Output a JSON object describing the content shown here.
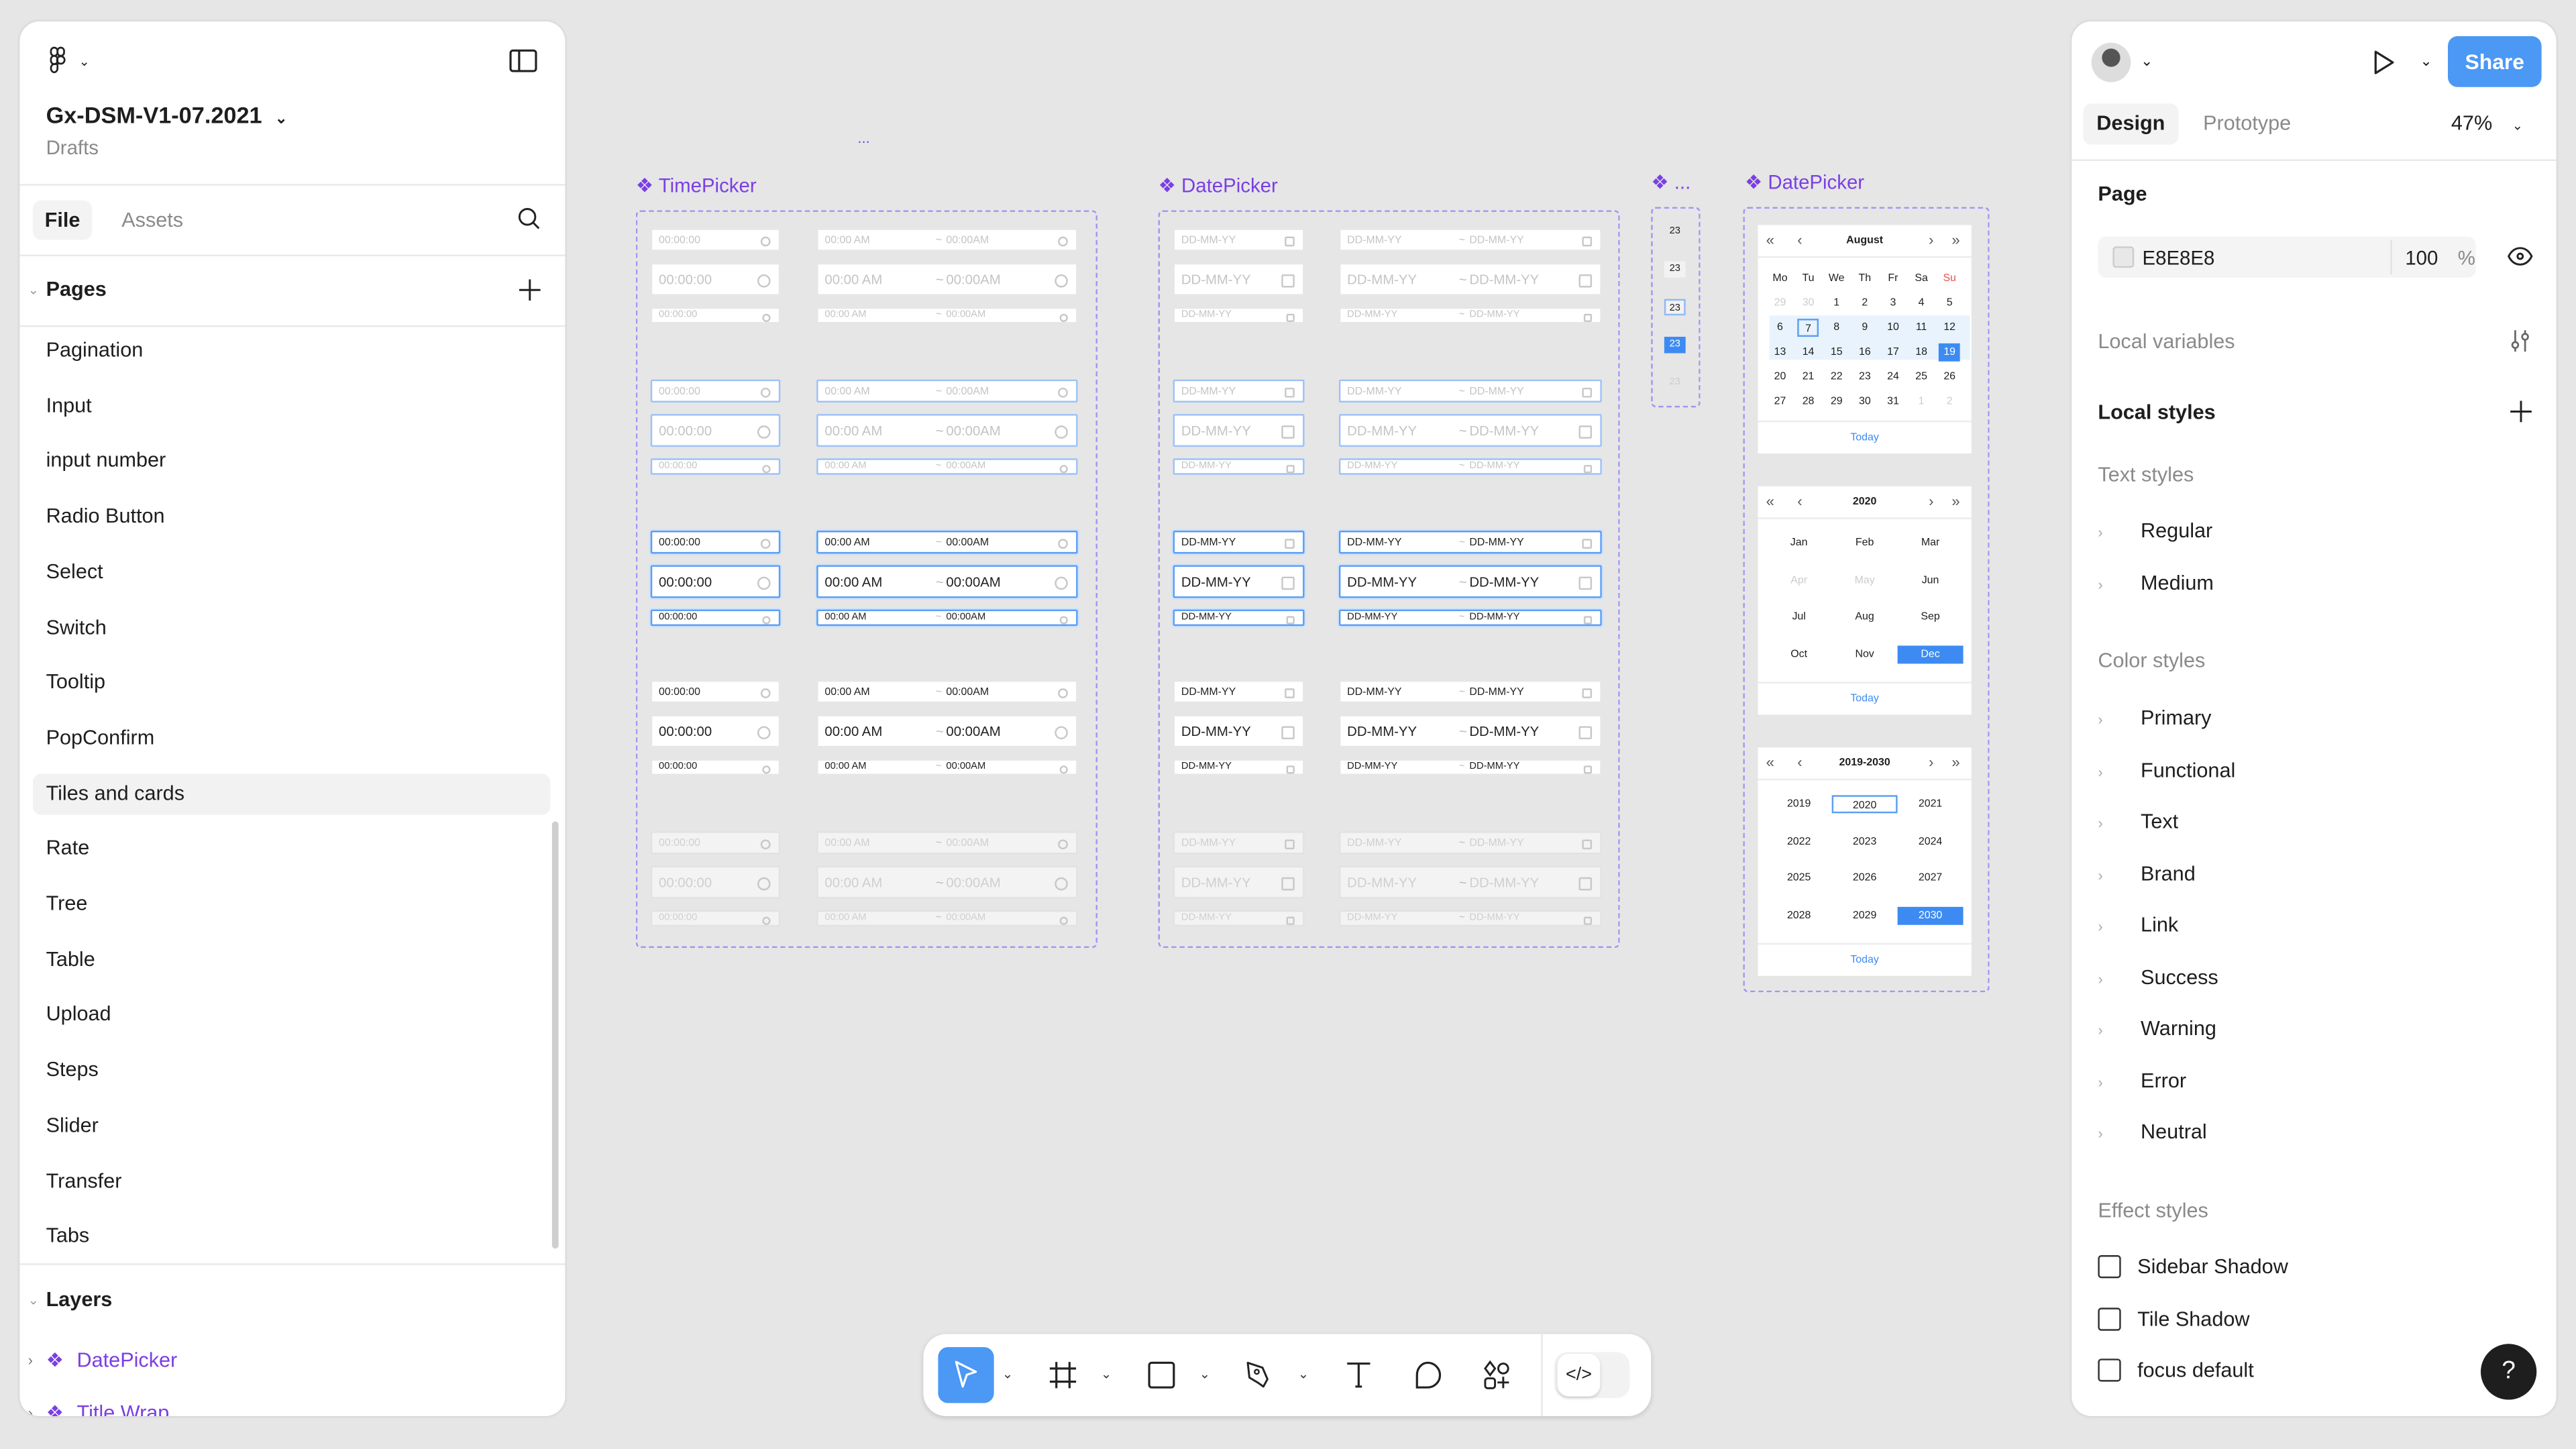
{
  "file": {
    "name": "Gx-DSM-V1-07.2021",
    "location": "Drafts"
  },
  "left_tabs": [
    "File",
    "Assets"
  ],
  "pages": {
    "title": "Pages",
    "items": [
      "Pagination",
      "Input",
      "input number",
      "Radio Button",
      "Select",
      "Switch",
      "Tooltip",
      "PopConfirm",
      "Tiles and cards",
      "Rate",
      "Tree",
      "Table",
      "Upload",
      "Steps",
      "Slider",
      "Transfer",
      "Tabs"
    ],
    "selected": "Tiles and cards"
  },
  "layers": {
    "title": "Layers",
    "items": [
      "DatePicker",
      "Title Wrap"
    ]
  },
  "canvas": {
    "top_ellipsis": "...",
    "timepicker": {
      "label": "TimePicker",
      "single": "00:00:00",
      "range_start": "00:00 AM",
      "range_sep": "~",
      "range_end": "00:00AM"
    },
    "datepicker": {
      "label": "DatePicker",
      "single": "DD-MM-YY",
      "range_start": "DD-MM-YY",
      "range_sep": "~",
      "range_end": "DD-MM-YY"
    },
    "cells": {
      "label": "...",
      "value": "23"
    },
    "calendar": {
      "label": "DatePicker",
      "month_title": "August",
      "weekdays": [
        "Mo",
        "Tu",
        "We",
        "Th",
        "Fr",
        "Sa",
        "Su"
      ],
      "days": [
        "29",
        "30",
        "1",
        "2",
        "3",
        "4",
        "5",
        "6",
        "7",
        "8",
        "9",
        "10",
        "11",
        "12",
        "13",
        "14",
        "15",
        "16",
        "17",
        "18",
        "19",
        "20",
        "21",
        "22",
        "23",
        "24",
        "25",
        "26",
        "27",
        "28",
        "29",
        "30",
        "31",
        "1",
        "2"
      ],
      "today_day": "7",
      "selected_day": "19",
      "year_title": "2020",
      "months": [
        "Jan",
        "Feb",
        "Mar",
        "Apr",
        "May",
        "Jun",
        "Jul",
        "Aug",
        "Sep",
        "Oct",
        "Nov",
        "Dec"
      ],
      "selected_month": "Dec",
      "decade_title": "2019-2030",
      "years": [
        "2019",
        "2020",
        "2021",
        "2022",
        "2023",
        "2024",
        "2025",
        "2026",
        "2027",
        "2028",
        "2029",
        "2030"
      ],
      "current_year": "2020",
      "selected_year": "2030",
      "today_label": "Today"
    }
  },
  "right": {
    "share": "Share",
    "tabs": [
      "Design",
      "Prototype"
    ],
    "zoom": "47%",
    "page_title": "Page",
    "page_color": "E8E8E8",
    "page_opacity": "100",
    "percent": "%",
    "local_variables": "Local variables",
    "local_styles": "Local styles",
    "text_styles": {
      "title": "Text styles",
      "items": [
        "Regular",
        "Medium"
      ]
    },
    "color_styles": {
      "title": "Color styles",
      "items": [
        "Primary",
        "Functional",
        "Text",
        "Brand",
        "Link",
        "Success",
        "Warning",
        "Error",
        "Neutral"
      ]
    },
    "effect_styles": {
      "title": "Effect styles",
      "items": [
        "Sidebar Shadow",
        "Tile Shadow",
        "focus default"
      ]
    },
    "help": "?"
  },
  "colors": {
    "accent": "#4b98f5",
    "component": "#7b3fe4",
    "canvas": "#E8E8E8"
  }
}
